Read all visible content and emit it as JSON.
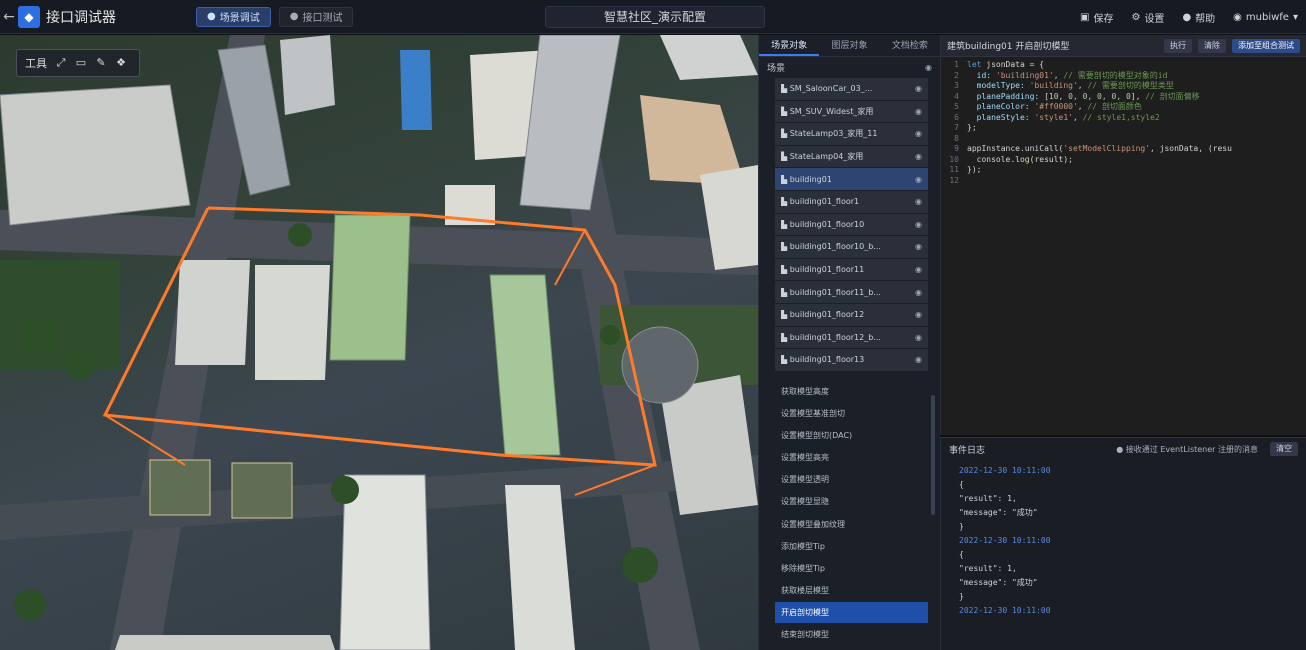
{
  "app": {
    "title": "接口调试器",
    "center_title": "智慧社区_演示配置"
  },
  "modes": [
    {
      "label": "场景调试",
      "active": true
    },
    {
      "label": "接口测试",
      "active": false
    }
  ],
  "topright": {
    "save": "保存",
    "settings": "设置",
    "help": "帮助",
    "user": "mubiwfe"
  },
  "tools": {
    "label": "工具"
  },
  "layer_panel": {
    "tabs": [
      "场景对象",
      "图层对象",
      "文档检索"
    ],
    "root_label": "场景",
    "items": [
      "SM_SaloonCar_03_...",
      "SM_SUV_Widest_家用",
      "StateLamp03_家用_11",
      "StateLamp04_家用",
      "building01",
      "building01_floor1",
      "building01_floor10",
      "building01_floor10_b...",
      "building01_floor11",
      "building01_floor11_b...",
      "building01_floor12",
      "building01_floor12_b...",
      "building01_floor13"
    ],
    "functions": [
      "获取模型高度",
      "设置模型基准剖切",
      "设置模型剖切(DAC)",
      "设置模型高亮",
      "设置模型透明",
      "设置模型显隐",
      "设置模型叠加纹理",
      "添加模型Tip",
      "移除模型Tip",
      "获取楼层模型",
      "开启剖切模型",
      "结束剖切模型"
    ],
    "active_function_index": 10
  },
  "code_panel": {
    "title": "建筑building01 开启剖切模型",
    "buttons": [
      "执行",
      "清除",
      "添加至组合测试"
    ],
    "line_numbers": [
      "1",
      "2",
      "3",
      "4",
      "5",
      "6",
      "7",
      "8",
      "9",
      "10",
      "11",
      "12"
    ],
    "lines": [
      [
        "kw:let ",
        "text:jsonData = {"
      ],
      [
        "prop:  id: ",
        "str:'building01'",
        "text:, ",
        "cm:// 需要剖切的模型对象的id"
      ],
      [
        "prop:  modelType: ",
        "str:'building'",
        "text:, ",
        "cm:// 需要剖切的模型类型"
      ],
      [
        "prop:  planePadding: ",
        "text:[",
        "num:10, 0, 0, 0, 0, 0",
        "text:], ",
        "cm:// 剖切面偏移"
      ],
      [
        "prop:  planeColor: ",
        "str:'#ff0000'",
        "text:, ",
        "cm:// 剖切面颜色"
      ],
      [
        "prop:  planeStyle: ",
        "str:'style1'",
        "text:, ",
        "cm:// style1,style2"
      ],
      [
        "text:};"
      ],
      [
        "text:"
      ],
      [
        "text:appInstance.uniCall(",
        "str:'setModelClipping'",
        "text:, jsonData, (resu"
      ],
      [
        "text:  console.",
        "fn:log",
        "text:(result);"
      ],
      [
        "text:});"
      ],
      [
        "text:"
      ]
    ]
  },
  "log_panel": {
    "title": "事件日志",
    "listener_label": "● 接收通过 EventListener 注册的消息",
    "clear_label": "清空",
    "entries": [
      {
        "ts": "2022-12-30 10:11:00",
        "result_line": "\"result\": 1,",
        "message_line": "\"message\": \"成功\""
      },
      {
        "ts": "2022-12-30 10:11:00",
        "result_line": "\"result\": 1,",
        "message_line": "\"message\": \"成功\""
      },
      {
        "ts": "2022-12-30 10:11:00"
      }
    ]
  }
}
